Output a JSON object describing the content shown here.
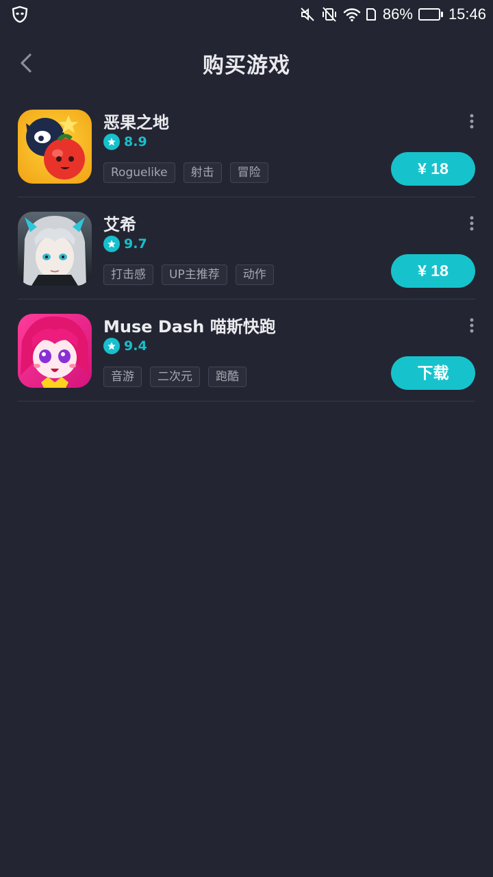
{
  "status_bar": {
    "battery": "86%",
    "time": "15:46",
    "battery_level": 0.86,
    "icons": [
      "shield-mask-icon",
      "mute-icon",
      "vibrate-off-icon",
      "wifi-icon",
      "sim-icon",
      "battery-icon"
    ]
  },
  "header": {
    "title": "购买游戏",
    "back_icon": "chevron-left-icon"
  },
  "colors": {
    "background": "#232632",
    "accent": "#16c3cc",
    "divider": "#363a47",
    "tag_text": "#a5a8b3"
  },
  "games": [
    {
      "name": "恶果之地",
      "rating": "8.9",
      "tags": [
        "Roguelike",
        "射击",
        "冒险"
      ],
      "action": "¥ 18"
    },
    {
      "name": "艾希",
      "rating": "9.7",
      "tags": [
        "打击感",
        "UP主推荐",
        "动作"
      ],
      "action": "¥ 18"
    },
    {
      "name": "Muse Dash 喵斯快跑",
      "rating": "9.4",
      "tags": [
        "音游",
        "二次元",
        "跑酷"
      ],
      "action": "下载"
    }
  ]
}
